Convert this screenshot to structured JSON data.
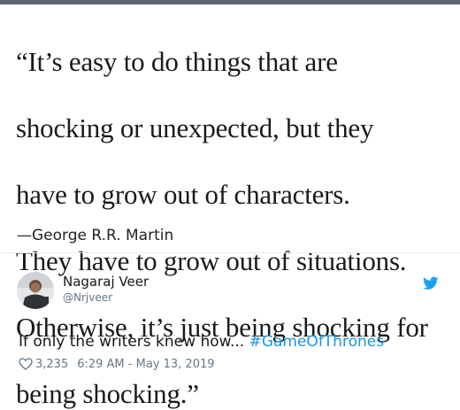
{
  "quote": {
    "lines": [
      "“It’s easy to do things that are",
      "shocking or unexpected, but they",
      "have to grow out of characters.",
      "They have to grow out of situations.",
      "Otherwise, it’s just being shocking for",
      "being shocking.”"
    ],
    "attribution": "—George R.R. Martin"
  },
  "tweet": {
    "author_name": "Nagaraj Veer",
    "author_handle": "@Nrjveer",
    "text": "If only the writers knew how... ",
    "hashtag": "#GameOfThrones",
    "like_count": "3,235",
    "timestamp": "6:29 AM - May 13, 2019"
  },
  "colors": {
    "hashtag": "#1b95e0",
    "twitter_brand": "#1da1f2",
    "meta_text": "#657786",
    "top_bar": "#5c6470"
  },
  "icons": {
    "brand": "twitter-bird-icon",
    "like": "heart-icon",
    "avatar": "user-avatar"
  }
}
